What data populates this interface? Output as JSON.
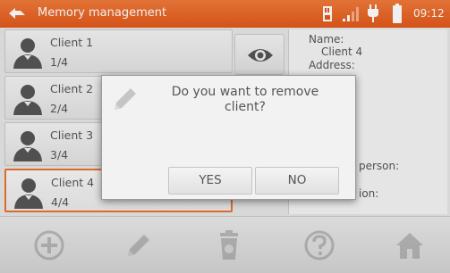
{
  "status_bar": {
    "title": "Memory management",
    "time": "09:12",
    "icons": [
      "back-icon",
      "sd-card-icon",
      "signal-icon",
      "plug-icon",
      "battery-icon"
    ]
  },
  "clients": [
    {
      "name": "Client 1",
      "index": "1/4"
    },
    {
      "name": "Client 2",
      "index": "2/4"
    },
    {
      "name": "Client 3",
      "index": "3/4"
    },
    {
      "name": "Client 4",
      "index": "4/4"
    }
  ],
  "details": {
    "name_label": "Name:",
    "name_value": "Client 4",
    "address_label": "Address:",
    "contact_label_fragment": "person:",
    "desc_label_fragment": "ion:"
  },
  "dialog": {
    "message": "Do you want to remove client?",
    "yes_label": "YES",
    "no_label": "NO"
  },
  "toolbar": {
    "icons": [
      "add-icon",
      "edit-icon",
      "delete-icon",
      "help-icon",
      "home-icon"
    ]
  },
  "colors": {
    "accent": "#e8732e",
    "status_bar": "#e2581a",
    "text": "#555555"
  }
}
